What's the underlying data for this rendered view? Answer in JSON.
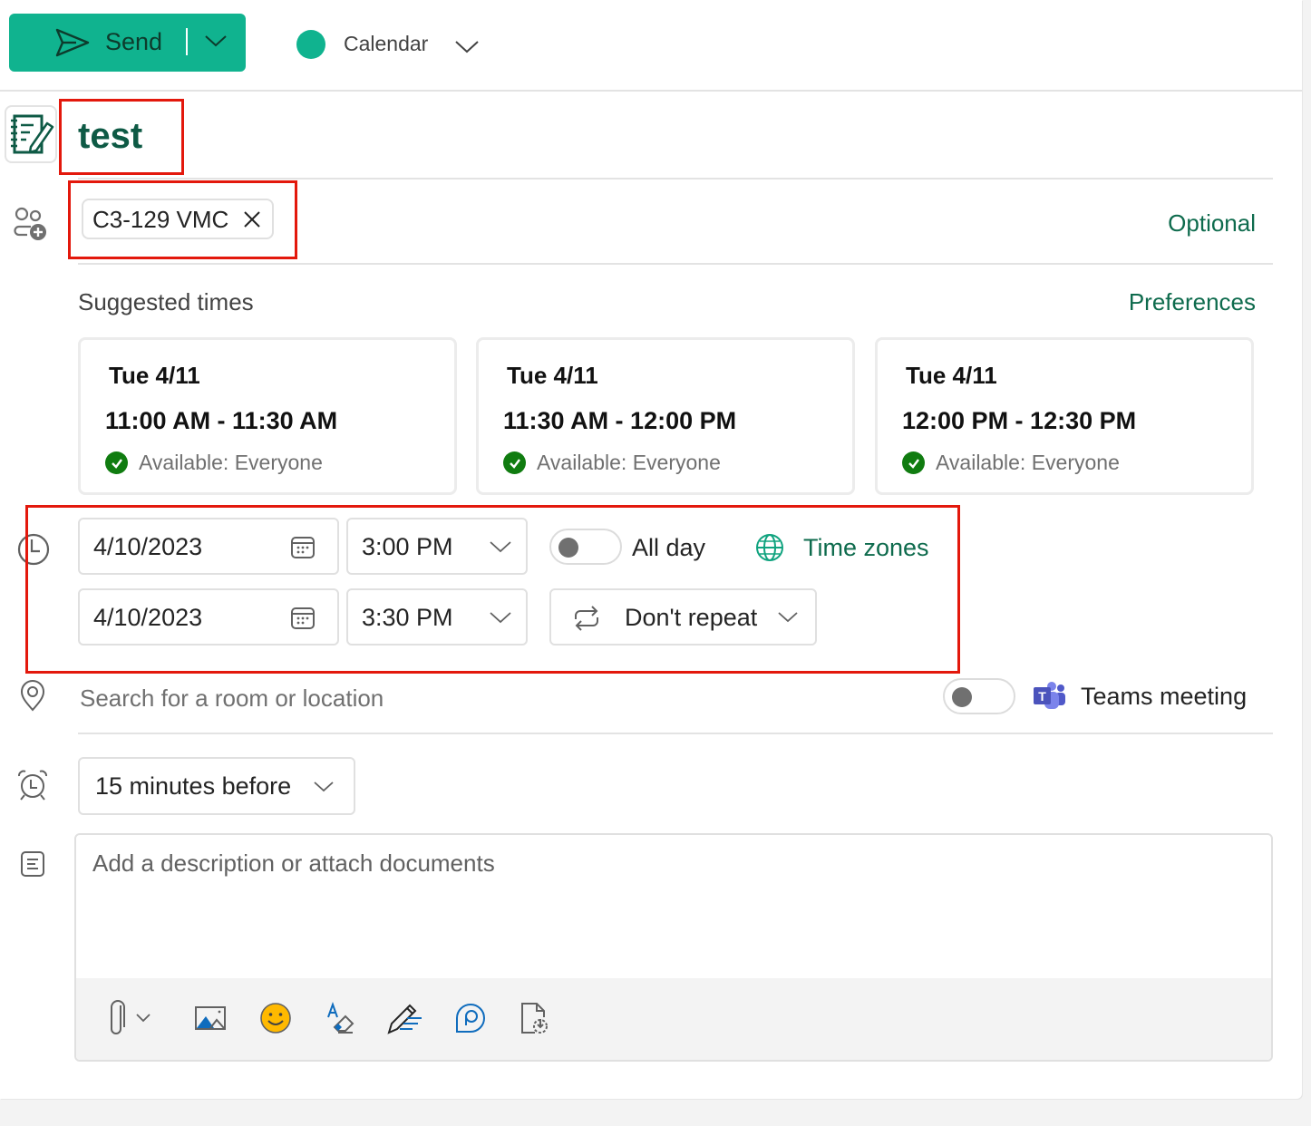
{
  "toolbar": {
    "send_label": "Send",
    "calendar_label": "Calendar",
    "accent_color": "#10b38f"
  },
  "event": {
    "title": "test"
  },
  "attendees": {
    "chips": [
      {
        "label": "C3-129 VMC"
      }
    ],
    "optional_link": "Optional"
  },
  "suggested": {
    "title": "Suggested times",
    "preferences_link": "Preferences",
    "cards": [
      {
        "date": "Tue 4/11",
        "time": "11:00 AM - 11:30 AM",
        "availability": "Available: Everyone"
      },
      {
        "date": "Tue 4/11",
        "time": "11:30 AM - 12:00 PM",
        "availability": "Available: Everyone"
      },
      {
        "date": "Tue 4/11",
        "time": "12:00 PM - 12:30 PM",
        "availability": "Available: Everyone"
      }
    ]
  },
  "datetime": {
    "start_date": "4/10/2023",
    "start_time": "3:00 PM",
    "end_date": "4/10/2023",
    "end_time": "3:30 PM",
    "all_day_label": "All day",
    "all_day_on": false,
    "time_zones_link": "Time zones",
    "repeat_label": "Don't repeat"
  },
  "location": {
    "placeholder": "Search for a room or location",
    "teams_label": "Teams meeting",
    "teams_on": false
  },
  "reminder": {
    "value": "15 minutes before"
  },
  "description": {
    "placeholder": "Add a description or attach documents",
    "toolbar_icons": [
      "paperclip-icon",
      "image-icon",
      "emoji-icon",
      "format-eraser-icon",
      "signature-icon",
      "loop-icon",
      "file-insert-icon"
    ]
  }
}
